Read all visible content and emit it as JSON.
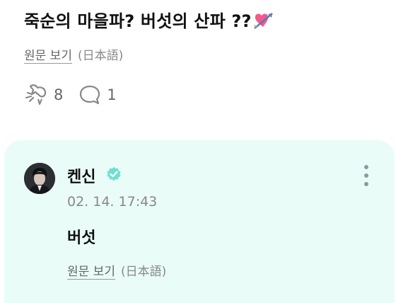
{
  "post": {
    "text": "죽순의 마을파? 버섯의 산파 ??",
    "emoji_icon": "heart-with-arrow-icon",
    "view_original": "원문 보기",
    "original_lang": "(日本語)",
    "likes_count": "8",
    "comments_count": "1"
  },
  "reply": {
    "author": "켄신",
    "timestamp": "02. 14. 17:43",
    "text": "버섯",
    "view_original": "원문 보기",
    "original_lang": "(日本語)"
  },
  "colors": {
    "reply_bg": "#e9fcf8",
    "verified": "#6ee0d2",
    "heart": "#f25a8c"
  }
}
